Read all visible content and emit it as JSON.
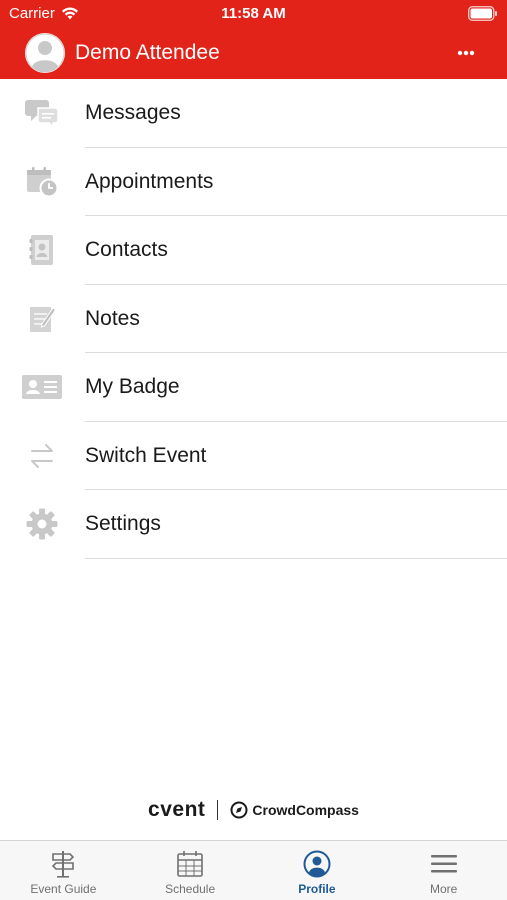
{
  "status_bar": {
    "carrier": "Carrier",
    "time": "11:58 AM"
  },
  "header": {
    "user_name": "Demo Attendee",
    "background_color": "#e2231a"
  },
  "menu": {
    "items": [
      {
        "label": "Messages",
        "icon": "messages-icon"
      },
      {
        "label": "Appointments",
        "icon": "appointments-icon"
      },
      {
        "label": "Contacts",
        "icon": "contacts-icon"
      },
      {
        "label": "Notes",
        "icon": "notes-icon"
      },
      {
        "label": "My Badge",
        "icon": "badge-icon"
      },
      {
        "label": "Switch Event",
        "icon": "switch-icon"
      },
      {
        "label": "Settings",
        "icon": "gear-icon"
      }
    ]
  },
  "footer": {
    "brand": "cvent",
    "partner": "CrowdCompass"
  },
  "tabbar": {
    "active_color": "#1f5a96",
    "tabs": [
      {
        "label": "Event Guide",
        "icon": "signpost-icon",
        "active": false
      },
      {
        "label": "Schedule",
        "icon": "calendar-icon",
        "active": false
      },
      {
        "label": "Profile",
        "icon": "profile-icon",
        "active": true
      },
      {
        "label": "More",
        "icon": "hamburger-icon",
        "active": false
      }
    ]
  }
}
